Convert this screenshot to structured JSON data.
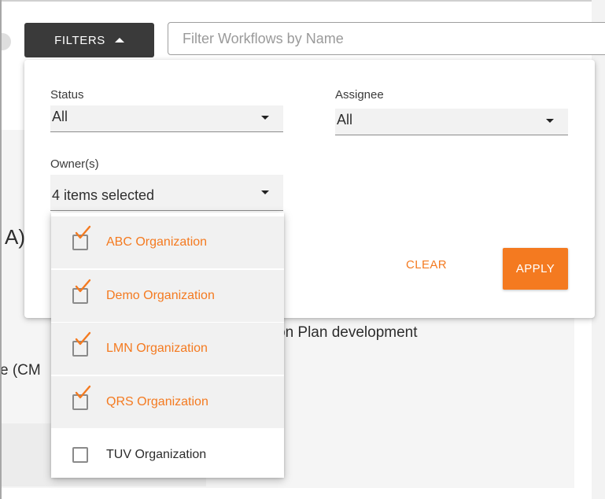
{
  "toolbar": {
    "filters_label": "FILTERS",
    "search_placeholder": "Filter Workflows by Name",
    "search_value": ""
  },
  "filters": {
    "status": {
      "label": "Status",
      "value": "All"
    },
    "assignee": {
      "label": "Assignee",
      "value": "All"
    },
    "owners": {
      "label": "Owner(s)",
      "value": "4 items selected",
      "options": [
        {
          "label": "ABC Organization",
          "checked": true
        },
        {
          "label": "Demo Organization",
          "checked": true
        },
        {
          "label": "LMN Organization",
          "checked": true
        },
        {
          "label": "QRS Organization",
          "checked": true
        },
        {
          "label": "TUV Organization",
          "checked": false
        }
      ]
    },
    "clear_label": "CLEAR",
    "apply_label": "APPLY"
  },
  "background": {
    "heading_fragment": "A)",
    "line1_fragment": "on Plan development",
    "line2_fragment": "e (CM"
  },
  "colors": {
    "accent": "#f47a20",
    "filters_button": "#3a3a3a"
  }
}
